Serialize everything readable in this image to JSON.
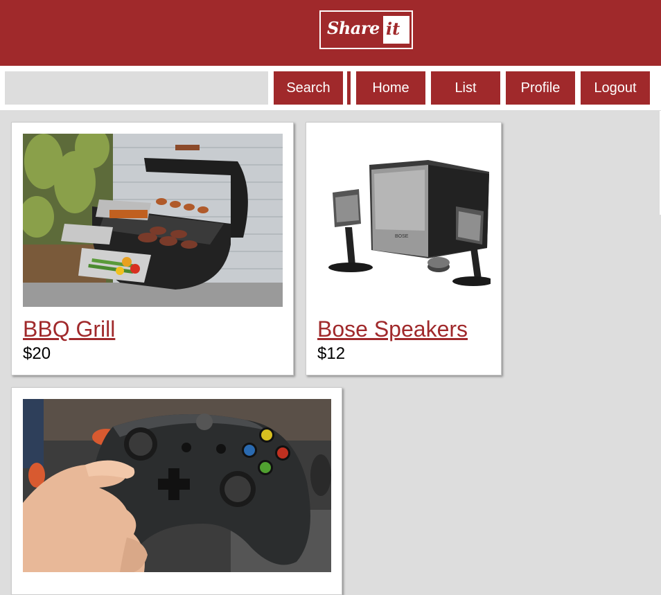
{
  "header": {
    "logo_word1": "Share",
    "logo_word2": "it"
  },
  "navbar": {
    "search_value": "",
    "search_placeholder": "",
    "search_label": "Search",
    "buttons": [
      "Home",
      "List",
      "Profile",
      "Logout"
    ]
  },
  "listings": [
    {
      "title": "BBQ Grill",
      "price": "$20",
      "image": "bbq-grill-photo"
    },
    {
      "title": "Bose Speakers",
      "price": "$12",
      "image": "speakers-photo"
    },
    {
      "title": "",
      "price": "",
      "image": "game-controller-photo"
    }
  ],
  "colors": {
    "brand": "#a0292b",
    "background": "#dddddd",
    "card": "#ffffff",
    "input": "#dddddd"
  }
}
